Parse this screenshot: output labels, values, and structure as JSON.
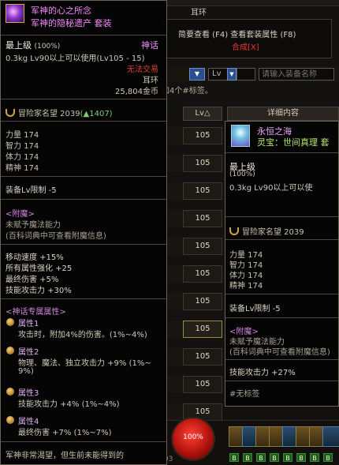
{
  "background": {
    "ear_tab": "耳环",
    "tooltip_hint": "简要查看 (F4) 查看套装属性 (F8)",
    "tooltip_compose": "合成[X]",
    "filter": {
      "dropdown_arrow": "▼",
      "lv_label": "Lv",
      "lv_arrow": "▼",
      "search_placeholder": "请输入装备名称"
    },
    "tag_label": "加4个#标签。",
    "table": {
      "header_lv": "Lv△",
      "header_detail": "详细内容",
      "rows": [
        "105",
        "105",
        "105",
        "105",
        "105",
        "105",
        "105",
        "105",
        "105",
        "105",
        "105"
      ],
      "selected_index": 7
    },
    "hp": "100%",
    "coord": ".03",
    "skill_keys": [
      "B",
      "B",
      "B",
      "B",
      "B",
      "B",
      "B",
      "B"
    ]
  },
  "left_item": {
    "name": "军神的心之所念",
    "set_name": "军神的隐秘遗产   套装",
    "grade": "最上级",
    "grade_pct": "(100%)",
    "rarity": "神话",
    "weight_line": "0.3kg   Lv90以上可以使用(Lv105 - 15)",
    "no_trade": "无法交易",
    "type": "耳环",
    "price": "25,804金币",
    "fame": "冒险家名望 2039",
    "fame_up": "(▲1407)",
    "stats": [
      "力量 174",
      "智力 174",
      "体力 174",
      "精神 174"
    ],
    "equip_limit": "装备Lv限制 -5",
    "enchant_title": "<附魔>",
    "enchant_line1": "未赋予魔法能力",
    "enchant_line2": "(百科词典中可查看附魔信息)",
    "bonus": [
      "移动速度 +15%",
      "所有属性强化 +25",
      "最终伤害 +5%",
      "技能攻击力 +30%"
    ],
    "mythic_title": "<神话专属属性>",
    "attr1_head": "属性1",
    "attr1_desc": "攻击时，附加4%的伤害。(1%~4%)",
    "attr2_head": "属性2",
    "attr2_desc1": "物理、魔法、独立攻击力 +9% (1%~",
    "attr2_desc2": "9%)",
    "attr3_head": "属性3",
    "attr3_desc": "技能攻击力 +4% (1%~4%)",
    "attr4_head": "属性4",
    "attr4_desc": "最终伤害 +7% (1%~7%)",
    "flavor": "军神非常渴望，但生前未能得到的"
  },
  "right_item": {
    "name": "永恒之海",
    "sub": "灵宝：世间真理  套",
    "grade": "最上级",
    "grade_pct": "(100%)",
    "weight_line": "0.3kg   Lv90以上可以使",
    "fame": "冒险家名望 2039",
    "stats": [
      "力量 174",
      "智力 174",
      "体力 174",
      "精神 174"
    ],
    "equip_limit": "装备Lv限制 -5",
    "enchant_title": "<附魔>",
    "enchant_line1": "未赋予魔法能力",
    "enchant_line2": "(百科词典中可查看附魔信息)",
    "skill_atk": "技能攻击力 +27%",
    "tag": "#无标签"
  }
}
